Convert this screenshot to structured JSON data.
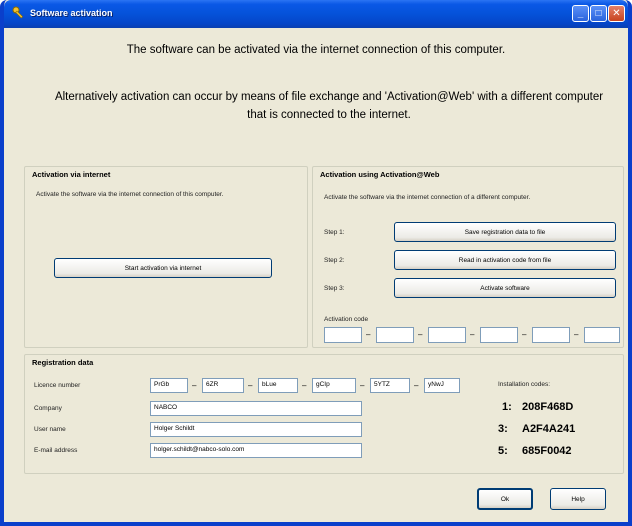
{
  "window": {
    "title": "Software activation",
    "buttons": {
      "minimize": "_",
      "maximize": "□",
      "close": "✕"
    }
  },
  "header": {
    "line1": "The software can be activated via the internet connection of this computer.",
    "line2": "Alternatively activation can occur by means of file exchange and 'Activation@Web' with a different computer that is connected to the internet."
  },
  "internet": {
    "title": "Activation via internet",
    "description": "Activate the software via the internet connection of this computer.",
    "start_button": "Start activation via internet"
  },
  "web": {
    "title": "Activation using Activation@Web",
    "description": "Activate the software via the internet connection of a different computer.",
    "steps": [
      {
        "label": "Step 1:",
        "button": "Save registration data to file"
      },
      {
        "label": "Step 2:",
        "button": "Read in activation code from file"
      },
      {
        "label": "Step 3:",
        "button": "Activate software"
      }
    ],
    "code_label": "Activation code",
    "code_fields": [
      "",
      "",
      "",
      "",
      "",
      ""
    ]
  },
  "registration": {
    "title": "Registration data",
    "license_label": "Licence number",
    "license_parts": [
      "PrGb",
      "6ZR",
      "bLue",
      "gCIp",
      "5YTZ",
      "yNwJ"
    ],
    "company_label": "Company",
    "company_value": "NABCO",
    "username_label": "User name",
    "username_value": "Holger Schildt",
    "email_label": "E-mail address",
    "email_value": "holger.schildt@nabco-solo.com",
    "installation_codes_label": "Installation codes:",
    "installation_codes": [
      {
        "index": "1:",
        "code": "208F468D"
      },
      {
        "index": "3:",
        "code": "A2F4A241"
      },
      {
        "index": "5:",
        "code": "685F0042"
      }
    ]
  },
  "footer": {
    "ok": "Ok",
    "help": "Help"
  },
  "colors": {
    "titlebar": "#0552d9",
    "window_bg": "#ece9d8",
    "border": "#0a3fcb"
  }
}
